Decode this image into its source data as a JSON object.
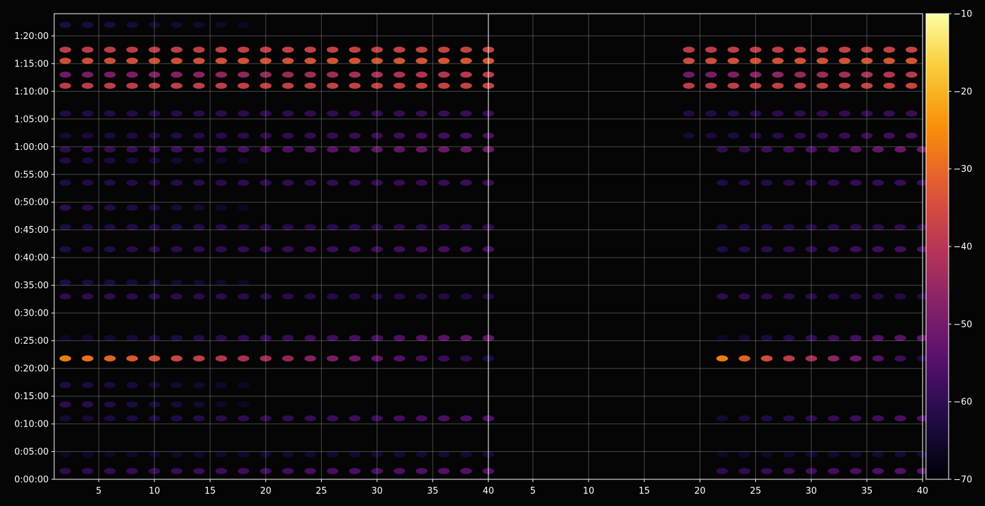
{
  "chart_data": {
    "type": "heatmap",
    "panels": [
      {
        "x_range": [
          1,
          40
        ],
        "x_ticks": [
          "5",
          "10",
          "15",
          "20",
          "25",
          "30",
          "35",
          "40"
        ]
      },
      {
        "x_range": [
          1,
          40
        ],
        "x_ticks": [
          "5",
          "10",
          "15",
          "20",
          "25",
          "30",
          "35",
          "40"
        ]
      }
    ],
    "y_range_minutes": [
      0,
      84
    ],
    "y_ticks": [
      "0:00:00",
      "0:05:00",
      "0:10:00",
      "0:15:00",
      "0:20:00",
      "0:25:00",
      "0:30:00",
      "0:35:00",
      "0:40:00",
      "0:45:00",
      "0:50:00",
      "0:55:00",
      "1:00:00",
      "1:05:00",
      "1:10:00",
      "1:15:00",
      "1:20:00"
    ],
    "colorbar": {
      "colormap": "inferno",
      "range": [
        -70,
        -10
      ],
      "ticks": [
        "−70",
        "−60",
        "−50",
        "−40",
        "−30",
        "−20",
        "−10"
      ]
    },
    "grid": true,
    "bands": [
      {
        "t": 1.5,
        "l": -60,
        "r": -54,
        "xmax": 40,
        "first_panel_only": false
      },
      {
        "t": 4.5,
        "l": -66,
        "r": -64,
        "xmax": 40,
        "first_panel_only": false
      },
      {
        "t": 11.0,
        "l": -64,
        "r": -55,
        "xmax": 40,
        "first_panel_only": false
      },
      {
        "t": 13.5,
        "l": -60,
        "r": -66,
        "xmax": 18,
        "first_panel_only": true
      },
      {
        "t": 17.0,
        "l": -62,
        "r": -66,
        "xmax": 18,
        "first_panel_only": true
      },
      {
        "t": 21.8,
        "l": -26,
        "r": -62,
        "xmax": 40,
        "first_panel_only": false
      },
      {
        "t": 25.5,
        "l": -66,
        "r": -52,
        "xmax": 40,
        "first_panel_only": false
      },
      {
        "t": 33.0,
        "l": -60,
        "r": -62,
        "xmax": 40,
        "first_panel_only": false
      },
      {
        "t": 35.5,
        "l": -62,
        "r": -66,
        "xmax": 18,
        "first_panel_only": true
      },
      {
        "t": 41.5,
        "l": -62,
        "r": -56,
        "xmax": 40,
        "first_panel_only": false
      },
      {
        "t": 45.5,
        "l": -62,
        "r": -60,
        "xmax": 40,
        "first_panel_only": false
      },
      {
        "t": 49.0,
        "l": -60,
        "r": -66,
        "xmax": 18,
        "first_panel_only": true
      },
      {
        "t": 53.5,
        "l": -62,
        "r": -58,
        "xmax": 40,
        "first_panel_only": false
      },
      {
        "t": 57.5,
        "l": -62,
        "r": -66,
        "xmax": 18,
        "first_panel_only": true
      },
      {
        "t": 59.5,
        "l": -60,
        "r": -50,
        "xmax": 40,
        "first_panel_only": false
      },
      {
        "t": 62.0,
        "l": -64,
        "r": -56,
        "xmax": 40,
        "first_panel_only": false
      },
      {
        "t": 66.0,
        "l": -62,
        "r": -58,
        "xmax": 40,
        "first_panel_only": false
      },
      {
        "t": 71.0,
        "l": -38,
        "r": -36,
        "xmax": 40,
        "first_panel_only": false
      },
      {
        "t": 73.0,
        "l": -50,
        "r": -38,
        "xmax": 40,
        "first_panel_only": false
      },
      {
        "t": 75.5,
        "l": -34,
        "r": -32,
        "xmax": 40,
        "first_panel_only": false
      },
      {
        "t": 77.5,
        "l": -38,
        "r": -36,
        "xmax": 40,
        "first_panel_only": false
      },
      {
        "t": 82.0,
        "l": -62,
        "r": -66,
        "xmax": 18,
        "first_panel_only": true
      }
    ]
  }
}
